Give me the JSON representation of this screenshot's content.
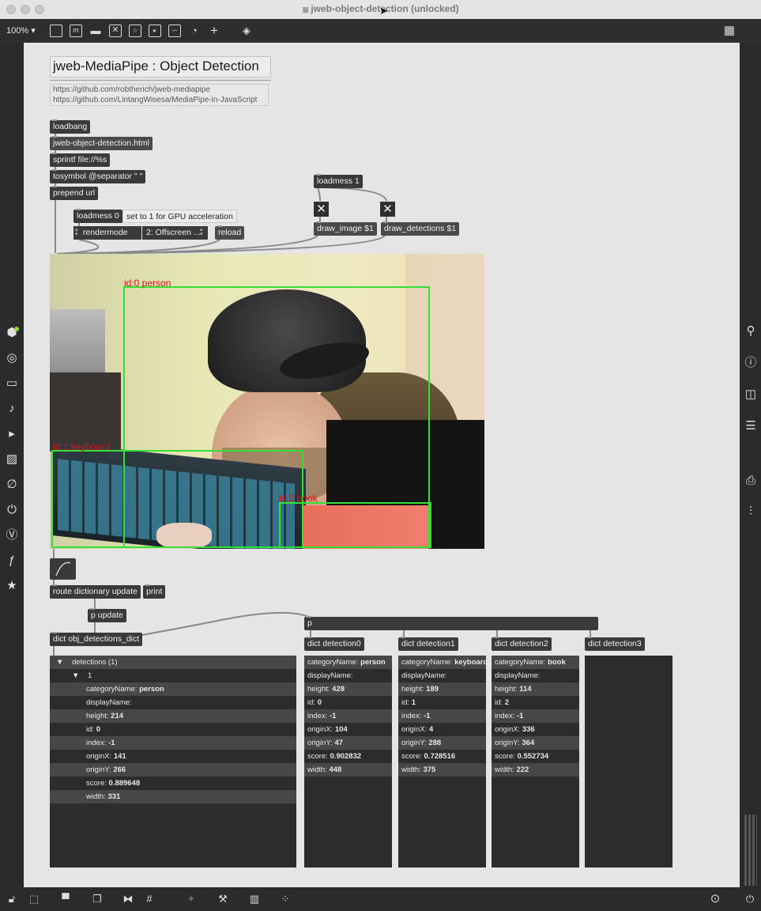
{
  "window": {
    "title": "jweb-object-detection (unlocked)"
  },
  "toolbar": {
    "zoom": "100%"
  },
  "header": {
    "title": "jweb-MediaPipe : Object Detection",
    "link1": "https://github.com/robtherich/jweb-mediapipe",
    "link2": "https://github.com/LintangWisesa/MediaPipe-in-JavaScript"
  },
  "objects": {
    "loadbang": "loadbang",
    "html_msg": "jweb-object-detection.html",
    "sprintf": "sprintf file://%s",
    "tosymbol": "tosymbol @separator \" \"",
    "prepend": "prepend url",
    "loadmess0": "loadmess 0",
    "gpu_comment": "set to 1 for GPU acceleration",
    "rendermode": "rendermode",
    "rendermode_value": "2: Offscreen ...",
    "reload": "reload",
    "loadmess1": "loadmess 1",
    "draw_image": "draw_image $1",
    "draw_detections": "draw_detections $1",
    "route": "route dictionary update",
    "print": "print",
    "p_update": "p update",
    "dict_main": "dict obj_detections_dict",
    "p": "p",
    "dict0": "dict detection0",
    "dict1": "dict detection1",
    "dict2": "dict detection2",
    "dict3": "dict detection3"
  },
  "video": {
    "labels": {
      "person": "id:0 person",
      "keyboard": "id:1 keyboard",
      "book": "id:2 book"
    },
    "colors": {
      "box": "#35e035",
      "label": "#e01010"
    }
  },
  "main_dict": {
    "root": "detections (1)",
    "index": "1",
    "rows": [
      {
        "key": "categoryName:",
        "val": "person"
      },
      {
        "key": "displayName:",
        "val": ""
      },
      {
        "key": "height:",
        "val": "214"
      },
      {
        "key": "id:",
        "val": "0"
      },
      {
        "key": "index:",
        "val": "-1"
      },
      {
        "key": "originX:",
        "val": "141"
      },
      {
        "key": "originY:",
        "val": "266"
      },
      {
        "key": "score:",
        "val": "0.889648"
      },
      {
        "key": "width:",
        "val": "331"
      }
    ]
  },
  "detection_dicts": [
    {
      "rows": [
        {
          "key": "categoryName:",
          "val": "person"
        },
        {
          "key": "displayName:",
          "val": ""
        },
        {
          "key": "height:",
          "val": "428"
        },
        {
          "key": "id:",
          "val": "0"
        },
        {
          "key": "index:",
          "val": "-1"
        },
        {
          "key": "originX:",
          "val": "104"
        },
        {
          "key": "originY:",
          "val": "47"
        },
        {
          "key": "score:",
          "val": "0.902832"
        },
        {
          "key": "width:",
          "val": "448"
        }
      ]
    },
    {
      "rows": [
        {
          "key": "categoryName:",
          "val": "keyboard"
        },
        {
          "key": "displayName:",
          "val": ""
        },
        {
          "key": "height:",
          "val": "189"
        },
        {
          "key": "id:",
          "val": "1"
        },
        {
          "key": "index:",
          "val": "-1"
        },
        {
          "key": "originX:",
          "val": "4"
        },
        {
          "key": "originY:",
          "val": "288"
        },
        {
          "key": "score:",
          "val": "0.728516"
        },
        {
          "key": "width:",
          "val": "375"
        }
      ]
    },
    {
      "rows": [
        {
          "key": "categoryName:",
          "val": "book"
        },
        {
          "key": "displayName:",
          "val": ""
        },
        {
          "key": "height:",
          "val": "114"
        },
        {
          "key": "id:",
          "val": "2"
        },
        {
          "key": "index:",
          "val": "-1"
        },
        {
          "key": "originX:",
          "val": "336"
        },
        {
          "key": "originY:",
          "val": "364"
        },
        {
          "key": "score:",
          "val": "0.552734"
        },
        {
          "key": "width:",
          "val": "222"
        }
      ]
    },
    {
      "rows": []
    }
  ]
}
